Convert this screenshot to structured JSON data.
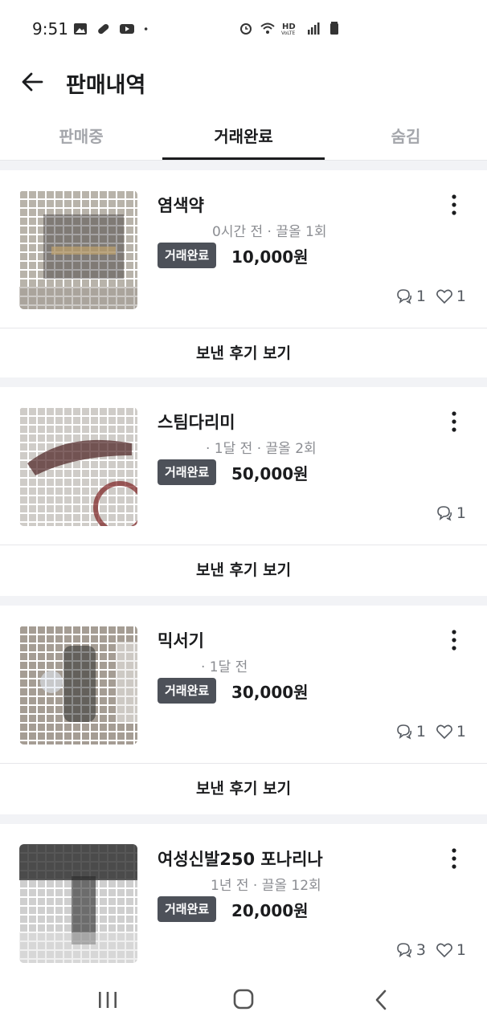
{
  "status": {
    "time": "9:51",
    "left_icons": [
      "gallery-icon",
      "pill-icon",
      "youtube-icon",
      "dot-icon"
    ],
    "right_icons": [
      "alarm-icon",
      "wifi-icon",
      "hd-voice-icon",
      "signal-icon",
      "battery-icon"
    ]
  },
  "header": {
    "title": "판매내역",
    "back_icon": "arrow-left-icon"
  },
  "tabs": [
    {
      "label": "판매중",
      "active": false
    },
    {
      "label": "거래완료",
      "active": true
    },
    {
      "label": "숨김",
      "active": false
    }
  ],
  "items": [
    {
      "title": "염색약",
      "meta": "0시간 전 · 끌올 1회",
      "status": "거래완료",
      "price": "10,000원",
      "chats": "1",
      "likes": "1",
      "review": "보낸 후기 보기"
    },
    {
      "title": "스팀다리미",
      "meta": "· 1달 전 · 끌올 2회",
      "status": "거래완료",
      "price": "50,000원",
      "chats": "1",
      "likes": null,
      "review": "보낸 후기 보기"
    },
    {
      "title": "믹서기",
      "meta": "· 1달 전",
      "status": "거래완료",
      "price": "30,000원",
      "chats": "1",
      "likes": "1",
      "review": "보낸 후기 보기"
    },
    {
      "title": "여성신발250 포나리나",
      "meta": "1년 전 · 끌올 12회",
      "status": "거래완료",
      "price": "20,000원",
      "chats": "3",
      "likes": "1",
      "review": null
    }
  ],
  "colors": {
    "badge_bg": "#4d5159",
    "text": "#1b1c1e",
    "muted": "#8b8d92",
    "divider": "#f2f3f6"
  },
  "nav": {
    "icons": [
      "recent-apps-icon",
      "home-icon",
      "back-icon"
    ]
  }
}
